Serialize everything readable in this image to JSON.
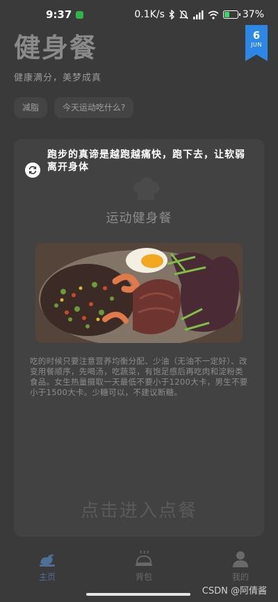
{
  "status_bar": {
    "time": "9:37",
    "net_speed": "0.1K/s",
    "battery_percent": "37%",
    "battery_level": 0.37
  },
  "header": {
    "title": "健身餐",
    "subtitle": "健康满分，美梦成真",
    "date_day": "6",
    "date_month": "JUN"
  },
  "tags": [
    "减脂",
    "今天运动吃什么?"
  ],
  "card": {
    "quote": "跑步的真谛是越跑越痛快，跑下去，让软弱离开身体",
    "title": "运动健身餐",
    "description": "吃的时候只要注意营养均衡分配、少油（无油不一定好）、改变用餐顺序，先喝汤，吃蔬菜，有饱足感后再吃肉和淀粉类食品。女生热量摄取一天最低不要小于1200大卡，男生不要小于1500大卡。少糖可以，不建议断糖。",
    "enter_label": "点击进入点餐"
  },
  "bottom_nav": [
    {
      "label": "主页",
      "icon": "home-bird-icon",
      "active": true
    },
    {
      "label": "背包",
      "icon": "food-cloche-icon",
      "active": false
    },
    {
      "label": "我的",
      "icon": "person-icon",
      "active": false
    }
  ],
  "watermark": "CSDN @阿倩酱",
  "colors": {
    "background": "#3a3a3a",
    "card": "#424242",
    "accent_blue": "#2d87e6",
    "active_nav": "#4f6f96"
  }
}
